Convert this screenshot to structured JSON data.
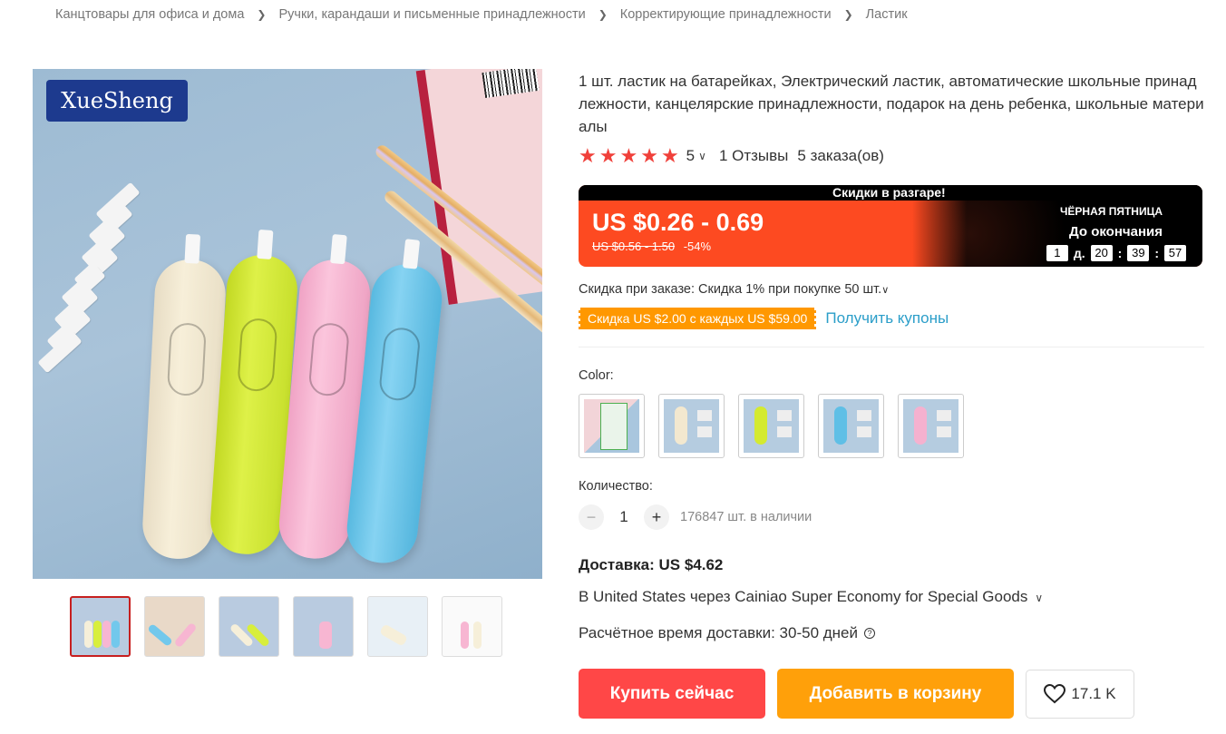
{
  "breadcrumb": [
    "Канцтовары для офиса и дома",
    "Ручки, карандаши и письменные принадлежности",
    "Корректирующие принадлежности",
    "Ластик"
  ],
  "image": {
    "brand": "XueSheng"
  },
  "title": "1 шт. ластик на батарейках, Электрический ластик, автоматические школьные принадлежности, канцелярские принадлежности, подарок на день ребенка, школьные материалы",
  "rating": {
    "value": "5",
    "reviews": "1 Отзывы",
    "orders": "5 заказа(ов)",
    "star_count": 5,
    "star_color": "#f0403a"
  },
  "price": {
    "hurry": "Скидки в разгаре!",
    "current": "US $0.26 - 0.69",
    "old": "US $0.56 - 1.50",
    "discount": "-54%",
    "event": "ЧЁРНАЯ ПЯТНИЦА",
    "until": "До окончания",
    "timer": {
      "days": "1",
      "days_unit": "д.",
      "hours": "20",
      "minutes": "39",
      "seconds": "57"
    },
    "accent": "#fd4a21"
  },
  "bulk": "Скидка при заказе: Скидка 1% при покупке 50 шт.",
  "coupon": {
    "badge": "Скидка US $2.00 с каждых US $59.00",
    "link": "Получить купоны",
    "badge_color": "#ff9800"
  },
  "color": {
    "label": "Color:",
    "options": [
      "pack",
      "cream",
      "lime",
      "blue",
      "pink"
    ]
  },
  "quantity": {
    "label": "Количество:",
    "value": "1",
    "minus": "−",
    "plus": "+",
    "stock": "176847 шт. в наличии"
  },
  "shipping": {
    "price": "Доставка: US $4.62",
    "method": "В United States через Cainiao Super Economy for Special Goods",
    "time": "Расчётное время доставки: 30-50 дней"
  },
  "actions": {
    "buy_now": "Купить сейчас",
    "add_to_cart": "Добавить в корзину",
    "wishlist_count": "17.1 K",
    "buy_color": "#ff4747",
    "cart_color": "#ffa00a"
  }
}
